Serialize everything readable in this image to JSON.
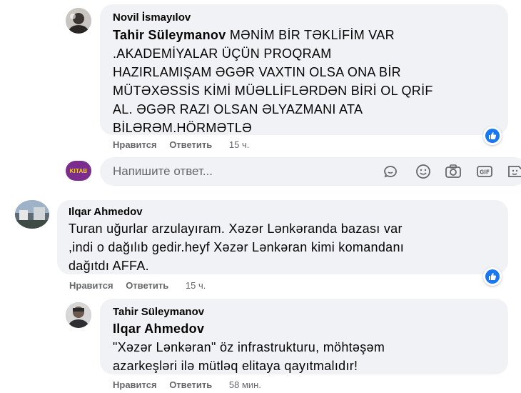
{
  "comments": [
    {
      "author": "Novil İsmayılov",
      "mention": "Tahir Süleymanov",
      "lines": [
        "MƏNİM BİR TƏKLİFİM VAR",
        ".AKADEMİYALAR ÜÇÜN PROQRAM",
        "HAZIRLAMIŞAM ƏGƏR VAXTIN OLSA ONA BİR",
        "MÜTƏXƏSSİS KİMİ MÜƏLLİFLƏRDƏN BİRİ OL QRİF",
        "AL. ƏGƏR RAZI OLSAN ƏLYAZMANI ATA",
        "BİLƏRƏM.HÖRMƏTLƏ"
      ],
      "like_label": "Нравится",
      "reply_label": "Ответить",
      "time": "15 ч."
    },
    {
      "author": "Ilqar Ahmedov",
      "lines": [
        "Turan uğurlar arzulayıram. Xəzər Lənkəranda bazası var",
        ",indi o dağılıb gedir.heyf Xəzər Lənkəran kimi komandanı",
        "dağıtdı AFFA."
      ],
      "like_label": "Нравится",
      "reply_label": "Ответить",
      "time": "15 ч."
    },
    {
      "author": "Tahir Süleymanov",
      "mention": "Ilqar Ahmedov",
      "lines": [
        "\"Xəzər Lənkəran\" öz infrastrukturu, möhtəşəm",
        "azarkeşləri ilə mütləq elitaya qayıtmalıdır!"
      ],
      "like_label": "Нравится",
      "reply_label": "Ответить",
      "time": "58 мин."
    }
  ],
  "reply": {
    "placeholder": "Напишите ответ...",
    "avatar_text": "KITAB",
    "icons": [
      "sticker-icon",
      "emoji-icon",
      "camera-icon",
      "gif-icon",
      "sticker-face-icon"
    ]
  },
  "colors": {
    "bubble": "#f0f2f5",
    "like_blue": "#1877f2",
    "secondary_text": "#65676b"
  }
}
